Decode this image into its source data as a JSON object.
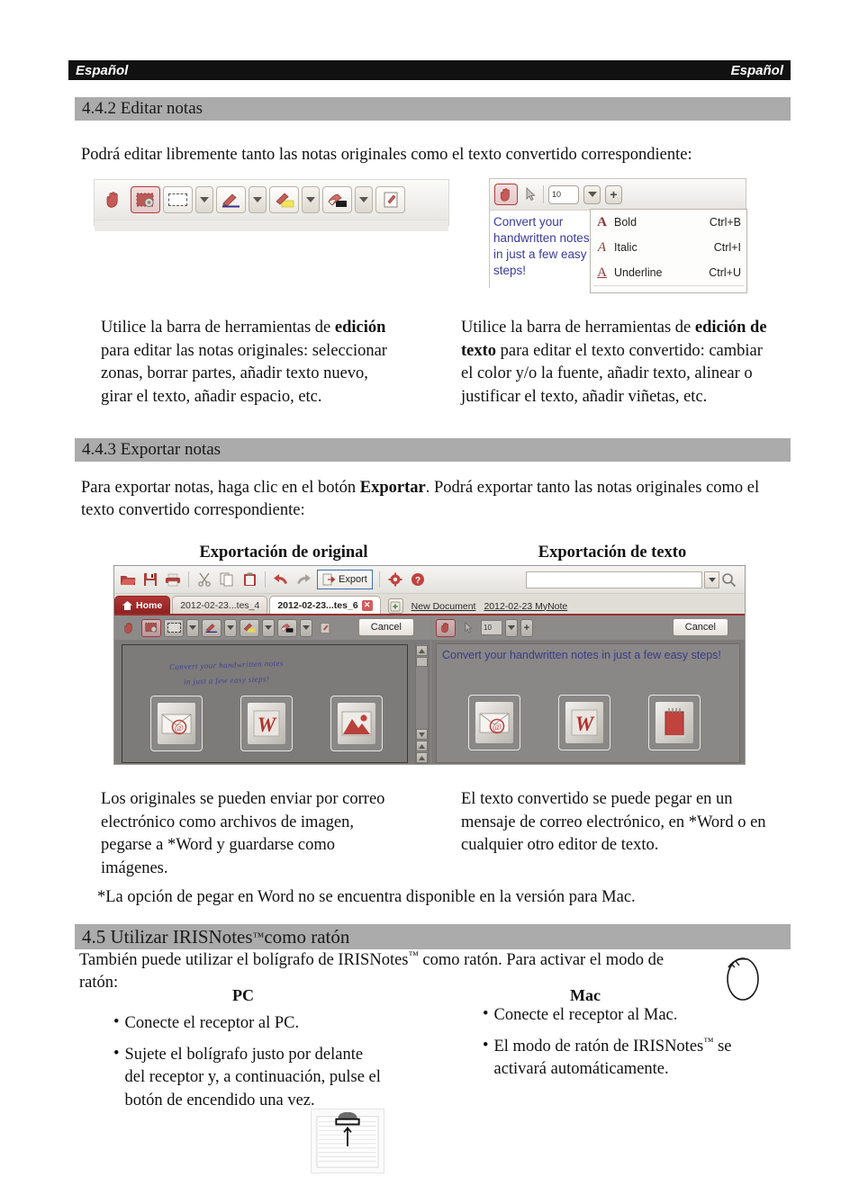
{
  "runhead": {
    "left": "Español",
    "right": "Español"
  },
  "sections": {
    "s442": "4.4.2 Editar notas",
    "s443": "4.4.3 Exportar notas",
    "s45_prefix": "4.5 Utilizar IRISNotes",
    "s45_tm": "™",
    "s45_suffix": " como ratón"
  },
  "paragraphs": {
    "p442": "Podrá editar libremente tanto las notas originales como el texto convertido correspondiente:",
    "p443_a": "Para exportar notas, haga clic en el botón ",
    "p443_b": "Exportar",
    "p443_c": ". Podrá exportar tanto las notas originales como el texto convertido correspondiente:",
    "footnote": "*La opción de pegar en Word no se encuentra disponible en la versión para Mac.",
    "p45_a": "También puede utilizar el bolígrafo de IRISNotes",
    "p45_tm": "™",
    "p45_b": " como ratón. Para activar el modo de ratón:"
  },
  "columns": {
    "edit_left_a": "Utilice la barra de herramientas de ",
    "edit_left_b": "edición",
    "edit_left_c": " para editar las notas originales: seleccionar zonas, borrar partes, añadir texto nuevo, girar el texto, añadir espacio, etc.",
    "edit_right_a": "Utilice la barra de herramientas de ",
    "edit_right_b": "edición de texto",
    "edit_right_c": " para editar el texto convertido: cambiar el color y/o la fuente, añadir texto, alinear o justificar el texto, añadir viñetas, etc.",
    "exp_left": "Los originales se pueden enviar por correo electrónico como archivos de imagen, pegarse a *Word y guardarse como imágenes.",
    "exp_right": "El texto convertido se puede pegar en un mensaje de correo electrónico, en *Word o en cualquier otro editor de texto."
  },
  "column_headings": {
    "left": "Exportación de original",
    "right": "Exportación de texto"
  },
  "edit_toolbar": {
    "tools": [
      {
        "name": "hand-tool",
        "selected": false,
        "has_dropdown": false
      },
      {
        "name": "select-settings-tool",
        "selected": true,
        "has_dropdown": false
      },
      {
        "name": "marquee-select-tool",
        "selected": false,
        "has_dropdown": true
      },
      {
        "name": "pen-tool",
        "selected": false,
        "has_dropdown": true
      },
      {
        "name": "highlighter-tool",
        "selected": false,
        "has_dropdown": true
      },
      {
        "name": "eraser-tool",
        "selected": false,
        "has_dropdown": true
      },
      {
        "name": "rotate-text-tool",
        "selected": false,
        "has_dropdown": false
      }
    ]
  },
  "text_toolbar": {
    "font_size": "10",
    "plus_label": "+",
    "note_text": "Convert your handwritten notes in just a few easy steps!",
    "menu": [
      {
        "glyph": "A",
        "label": "Bold",
        "shortcut": "Ctrl+B"
      },
      {
        "glyph": "A",
        "label": "Italic",
        "shortcut": "Ctrl+I"
      },
      {
        "glyph": "A",
        "label": "Underline",
        "shortcut": "Ctrl+U"
      }
    ]
  },
  "app": {
    "toolbar_icons": [
      "open-icon",
      "save-icon",
      "print-icon",
      "cut-icon",
      "copy-icon",
      "paste-icon",
      "undo-icon",
      "redo-icon",
      "settings-icon",
      "help-icon"
    ],
    "export_button": "Export",
    "search_value": "",
    "tabs": [
      {
        "label": "Home",
        "kind": "home"
      },
      {
        "label": "2012-02-23...tes_4",
        "kind": "inactive"
      },
      {
        "label": "2012-02-23...tes_6",
        "kind": "active",
        "close": "✕"
      }
    ],
    "right_links": [
      "New Document",
      "2012-02-23  MyNote"
    ],
    "cancel_label": "Cancel",
    "left_pane": {
      "handwriting_line1": "Convert your handwritten notes",
      "handwriting_line2": "in just a few easy steps!",
      "export_icons": [
        "email-export-icon",
        "word-export-icon",
        "image-export-icon"
      ]
    },
    "right_pane": {
      "font_size": "10",
      "plus_label": "+",
      "text": "Convert your handwritten notes in just a few easy steps!",
      "export_icons": [
        "email-export-icon",
        "word-export-icon",
        "notepad-export-icon"
      ]
    }
  },
  "mouse_section": {
    "pc_heading": "PC",
    "mac_heading": "Mac",
    "pc_bullets": [
      "Conecte el receptor al PC.",
      "Sujete el bolígrafo justo por delante del receptor y, a continuación, pulse el botón de encendido una vez."
    ],
    "mac_bullets_1": "Conecte el receptor al Mac.",
    "mac_bullets_2_a": "El modo de ratón de IRISNotes",
    "mac_bullets_2_tm": "™",
    "mac_bullets_2_b": " se activará automáticamente."
  },
  "colors": {
    "band": "#ababab",
    "runhead_bg": "#111111",
    "accent_red": "#9c2e2e",
    "focus_blue": "#3c6fb5",
    "ink_blue": "#3a3a9c"
  }
}
